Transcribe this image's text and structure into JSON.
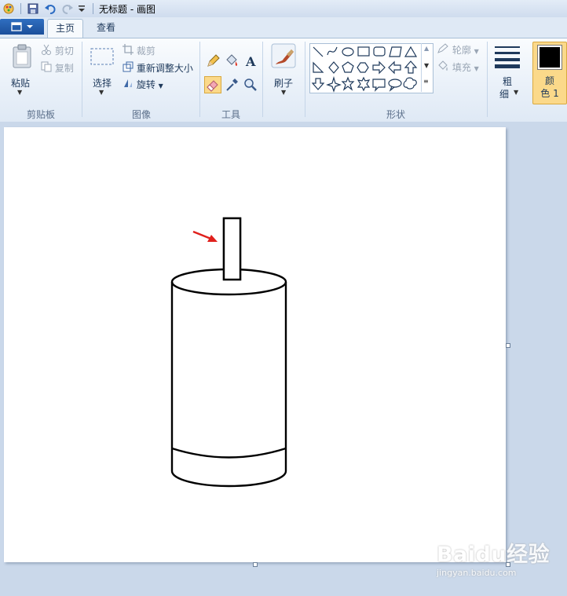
{
  "titlebar": {
    "title": "无标题 - 画图"
  },
  "tabs": [
    {
      "label": "主页",
      "active": true
    },
    {
      "label": "查看",
      "active": false
    }
  ],
  "clipboard": {
    "paste": "粘贴",
    "cut": "剪切",
    "copy": "复制",
    "group": "剪贴板"
  },
  "image": {
    "select": "选择",
    "crop": "裁剪",
    "resize": "重新调整大小",
    "rotate": "旋转",
    "group": "图像"
  },
  "tools": {
    "group": "工具"
  },
  "brushes": {
    "label": "刷子"
  },
  "shapes": {
    "outline": "轮廓",
    "fill": "填充",
    "group": "形状"
  },
  "size": {
    "label_line1": "粗",
    "label_line2": "细"
  },
  "color1": {
    "label_line1": "颜",
    "label_line2": "色 1",
    "value": "#000000"
  },
  "colors": {
    "accent": "#fbd98a",
    "annotation_arrow": "#e0201c"
  },
  "watermark": {
    "logo": "Baidu经验",
    "sub": "jingyan.baidu.com"
  }
}
